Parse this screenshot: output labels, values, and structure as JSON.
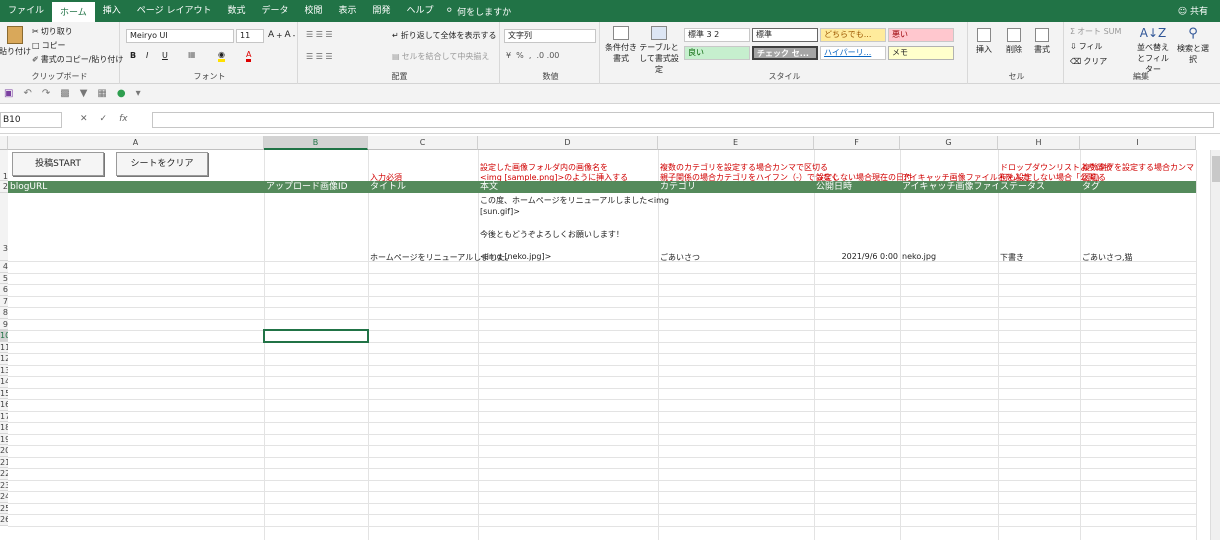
{
  "menu": {
    "tabs": [
      "ファイル",
      "ホーム",
      "挿入",
      "ページ レイアウト",
      "数式",
      "データ",
      "校閲",
      "表示",
      "開発",
      "ヘルプ"
    ],
    "tellme": "何をしますか",
    "share": "共有"
  },
  "ribbon": {
    "clipboard": {
      "paste": "貼り付け",
      "cut": "切り取り",
      "copy": "コピー",
      "format_painter": "書式のコピー/貼り付け",
      "label": "クリップボード"
    },
    "font": {
      "name": "Meiryo UI",
      "size": "11",
      "label": "フォント",
      "bold": "B",
      "italic": "I",
      "underline": "U"
    },
    "alignment": {
      "wrap": "折り返して全体を表示する",
      "merge": "セルを結合して中央揃え",
      "label": "配置"
    },
    "number": {
      "format": "文字列",
      "label": "数値"
    },
    "styles": {
      "conditional": "条件付き書式",
      "table": "テーブルとして書式設定",
      "label": "スタイル",
      "cells": [
        "標準 3 2",
        "標準",
        "どちらでも...",
        "悪い",
        "良い",
        "チェック セ...",
        "ハイパーリ...",
        "メモ"
      ]
    },
    "cells": {
      "insert": "挿入",
      "delete": "削除",
      "format": "書式",
      "label": "セル"
    },
    "editing": {
      "autosum": "オート SUM",
      "fill": "フィル",
      "clear": "クリア",
      "sort": "並べ替えとフィルター",
      "find": "検索と選択",
      "label": "編集"
    }
  },
  "formula_bar": {
    "name_box": "B10",
    "fx": "fx",
    "value": ""
  },
  "columns": [
    "A",
    "B",
    "C",
    "D",
    "E",
    "F",
    "G",
    "H",
    "I"
  ],
  "rows": [
    "1",
    "2",
    "3",
    "4",
    "5",
    "6",
    "7",
    "8",
    "9",
    "10",
    "11",
    "12",
    "13",
    "14",
    "15",
    "16",
    "17",
    "18",
    "19",
    "20",
    "21",
    "22",
    "23",
    "24",
    "25",
    "26"
  ],
  "buttons": {
    "post_start": "投稿START",
    "clear_sheet": "シートをクリア"
  },
  "notes": {
    "c": "入力必須",
    "d1": "設定した画像フォルダ内の画像名を",
    "d2": "<img [sample.png]>のように挿入する",
    "e1": "複数のカテゴリを設定する場合カンマで区切る",
    "e2": "親子関係の場合カテゴリをハイフン（-）でつなぐ",
    "f": "設定しない場合現在の日付",
    "g": "アイキャッチ画像ファイル名を入力",
    "h1": "ドロップダウンリストより選択",
    "h2": "何も設定しない場合「公開」",
    "i1": "複数タグを設定する場合カンマ（,）で",
    "i2": "区切る"
  },
  "headers": [
    "blogURL",
    "アップロード画像ID",
    "タイトル",
    "本文",
    "カテゴリ",
    "公開日時",
    "アイキャッチ画像ファイル名",
    "ステータス",
    "タグ"
  ],
  "row3": {
    "title": "ホームページをリニューアルしました。",
    "body1": "この度、ホームページをリニューアルしました<img",
    "body2": "[sun.gif]>",
    "body3": "今後ともどうぞよろしくお願いします！",
    "body4": "<img  [neko.jpg]>",
    "category": "ごあいさつ",
    "date": "2021/9/6 0:00",
    "eyecatch": "neko.jpg",
    "status": "下書き",
    "tags": "ごあいさつ,猫"
  },
  "colors": {
    "accent": "#217346",
    "header_green": "#548a5b",
    "note_red": "#d00000"
  }
}
